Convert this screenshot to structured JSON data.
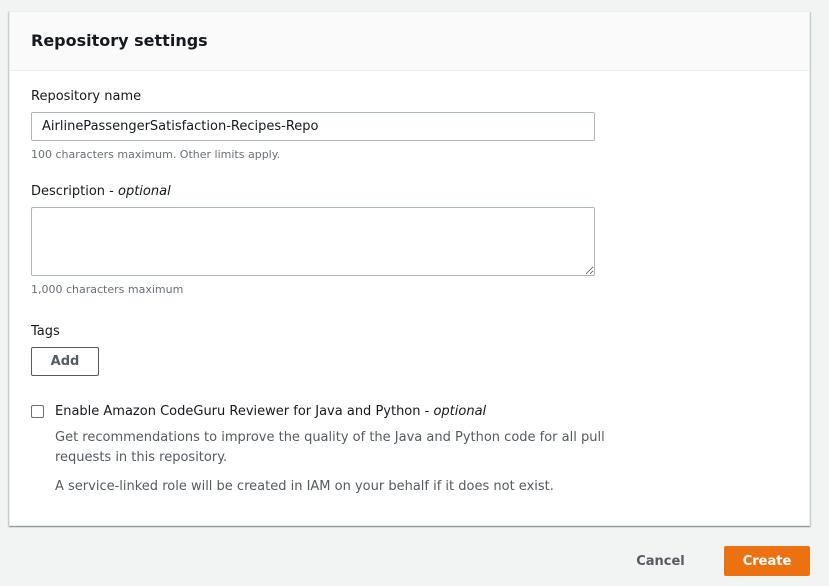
{
  "panel": {
    "title": "Repository settings"
  },
  "repository_name": {
    "label": "Repository name",
    "value": "AirlinePassengerSatisfaction-Recipes-Repo",
    "hint": "100 characters maximum. Other limits apply."
  },
  "description": {
    "label": "Description - ",
    "label_optional": "optional",
    "value": "",
    "hint": "1,000 characters maximum"
  },
  "tags": {
    "label": "Tags",
    "add_label": "Add"
  },
  "codeguru": {
    "label": "Enable Amazon CodeGuru Reviewer for Java and Python - ",
    "label_optional": "optional",
    "checked": false,
    "description": "Get recommendations to improve the quality of the Java and Python code for all pull requests in this repository.",
    "note": "A service-linked role will be created in IAM on your behalf if it does not exist."
  },
  "footer": {
    "cancel_label": "Cancel",
    "create_label": "Create"
  },
  "colors": {
    "primary_button": "#ec7211",
    "page_background": "#f2f3f3",
    "text": "#16191f",
    "secondary_text": "#545b64"
  }
}
